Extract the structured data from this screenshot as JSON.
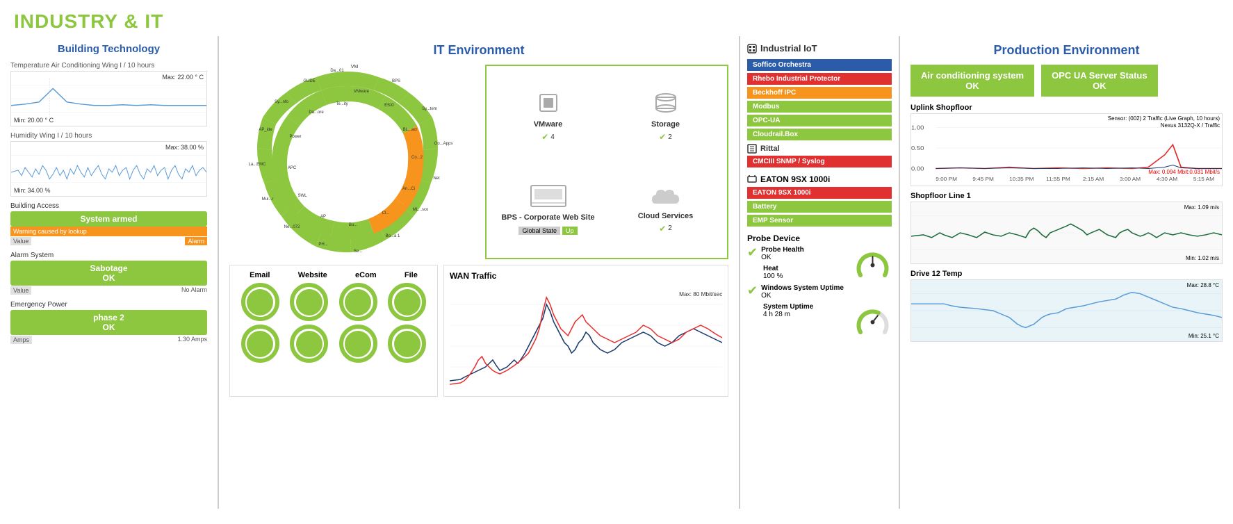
{
  "header": {
    "title": "INDUSTRY & IT"
  },
  "building": {
    "title": "Building Technology",
    "temp_chart": {
      "label": "Temperature Air Conditioning Wing I / 10 hours",
      "max": "Max: 22.00 ° C",
      "min": "Min: 20.00 ° C"
    },
    "humidity_chart": {
      "label": "Humidity Wing I / 10 hours",
      "max": "Max: 38.00 %",
      "min": "Min: 34.00 %"
    },
    "building_access": {
      "label": "Building Access",
      "status": "System armed",
      "warning": "Warning caused by lookup",
      "value_label": "Value",
      "alarm_label": "Alarm"
    },
    "alarm_system": {
      "label": "Alarm System",
      "status": "Sabotage",
      "ok": "OK",
      "value_label": "Value",
      "alarm_label": "No Alarm"
    },
    "emergency_power": {
      "label": "Emergency Power",
      "status": "phase 2",
      "ok": "OK",
      "amps_label": "Amps",
      "amps_value": "1.30 Amps"
    }
  },
  "it": {
    "title": "IT Environment",
    "vmware": {
      "label": "VMware",
      "count": "✔ 4"
    },
    "storage": {
      "label": "Storage",
      "count": "✔ 2"
    },
    "bps": {
      "label": "BPS - Corporate Web Site",
      "global_state": "Global State",
      "up": "Up"
    },
    "cloud": {
      "label": "Cloud Services",
      "count": "✔ 2"
    },
    "wan_title": "WAN Traffic",
    "wan_max": "Max: 80 Mbit/sec",
    "services": [
      "Email",
      "Website",
      "eCom",
      "File"
    ],
    "donut_labels": [
      "Sy...tem",
      "VM",
      "BPS...ssales",
      "Sy...tem",
      "Go...Apps",
      "Net...200",
      "ML...sco",
      "Bo...a 1",
      "Se...urity",
      "PH....",
      "Ne...072",
      "Mul...r Lun",
      "La...EMC...Cl....",
      "AP...ide",
      "Sy...nfo...20",
      "GUDE...P.VZE",
      "Da...ore",
      "Te...ity",
      "Da...01",
      "VMware",
      "ESXI",
      "BL...acr",
      "Co...2",
      "An...Ci...tch",
      "Cl...",
      "Bu...ssas",
      "AP...ide",
      "SWL...kTU",
      "APC",
      "Power"
    ]
  },
  "iot": {
    "title": "Industrial IoT",
    "items": [
      {
        "label": "Soffico Orchestra",
        "color": "blue"
      },
      {
        "label": "Rhebo Industrial Protector",
        "color": "red"
      },
      {
        "label": "Beckhoff IPC",
        "color": "orange"
      },
      {
        "label": "Modbus",
        "color": "green"
      },
      {
        "label": "OPC-UA",
        "color": "green"
      },
      {
        "label": "Cloudrail.Box",
        "color": "green"
      }
    ],
    "rittal_label": "Rittal",
    "rittal_sub": "CMCIII SNMP / Syslog",
    "eaton": {
      "title": "EATON 9SX 1000i",
      "items": [
        {
          "label": "EATON 9SX 1000i",
          "color": "red"
        },
        {
          "label": "Battery",
          "color": "green"
        },
        {
          "label": "EMP Sensor",
          "color": "green"
        }
      ]
    },
    "probe": {
      "title": "Probe Device",
      "items": [
        {
          "name": "Probe Health",
          "status": "OK",
          "value": ""
        },
        {
          "name": "Heat",
          "status": "100 %",
          "value": ""
        },
        {
          "name": "Windows System Uptime",
          "status": "OK",
          "value": ""
        },
        {
          "name": "System Uptime",
          "status": "4 h 28 m",
          "value": ""
        }
      ]
    }
  },
  "production": {
    "title": "Production Environment",
    "badges": [
      {
        "label": "Air conditioning system",
        "status": "OK"
      },
      {
        "label": "OPC UA Server Status",
        "status": "OK"
      }
    ],
    "uplink": {
      "title": "Uplink Shopfloor",
      "note1": "Sensor: (002) 2 Traffic (Live Graph, 10 hours)",
      "note2": "Nexus 3132Q-X / Traffic",
      "max": "Max: 0.094 Mbit:0.031 Mbit/s",
      "y_labels": [
        "1.00",
        "0.50",
        "0.00"
      ]
    },
    "shopfloor": {
      "title": "Shopfloor Line 1",
      "max": "Max: 1.09 m/s",
      "min": "Min: 1.02 m/s"
    },
    "drive": {
      "title": "Drive 12 Temp",
      "max": "Max: 28.8 °C",
      "min": "Min: 25.1 °C"
    }
  }
}
